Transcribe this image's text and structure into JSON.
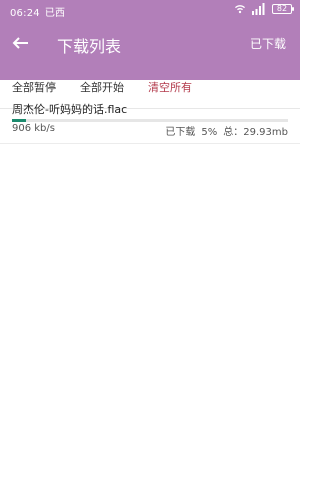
{
  "status_bar": {
    "time": "06:24",
    "carrier": "已西",
    "battery": "82"
  },
  "app_bar": {
    "title": "下载列表",
    "downloaded_label": "已下载"
  },
  "tabs": [
    {
      "label": "全部暂停"
    },
    {
      "label": "全部开始"
    },
    {
      "label": "清空所有"
    }
  ],
  "downloads": [
    {
      "file_name": "周杰伦-听妈妈的话.flac",
      "speed": "906 kb/s",
      "status": "已下载",
      "percent": "5%",
      "total_label": "总：",
      "total_size": "29.93mb",
      "progress": 0.05
    }
  ],
  "colors": {
    "header": "#b27fb9",
    "progress": "#1c8b6e",
    "clear_tab": "#b33c4d"
  },
  "icons": [
    "wifi-icon",
    "signal-icon",
    "battery-icon",
    "back-arrow-icon"
  ]
}
